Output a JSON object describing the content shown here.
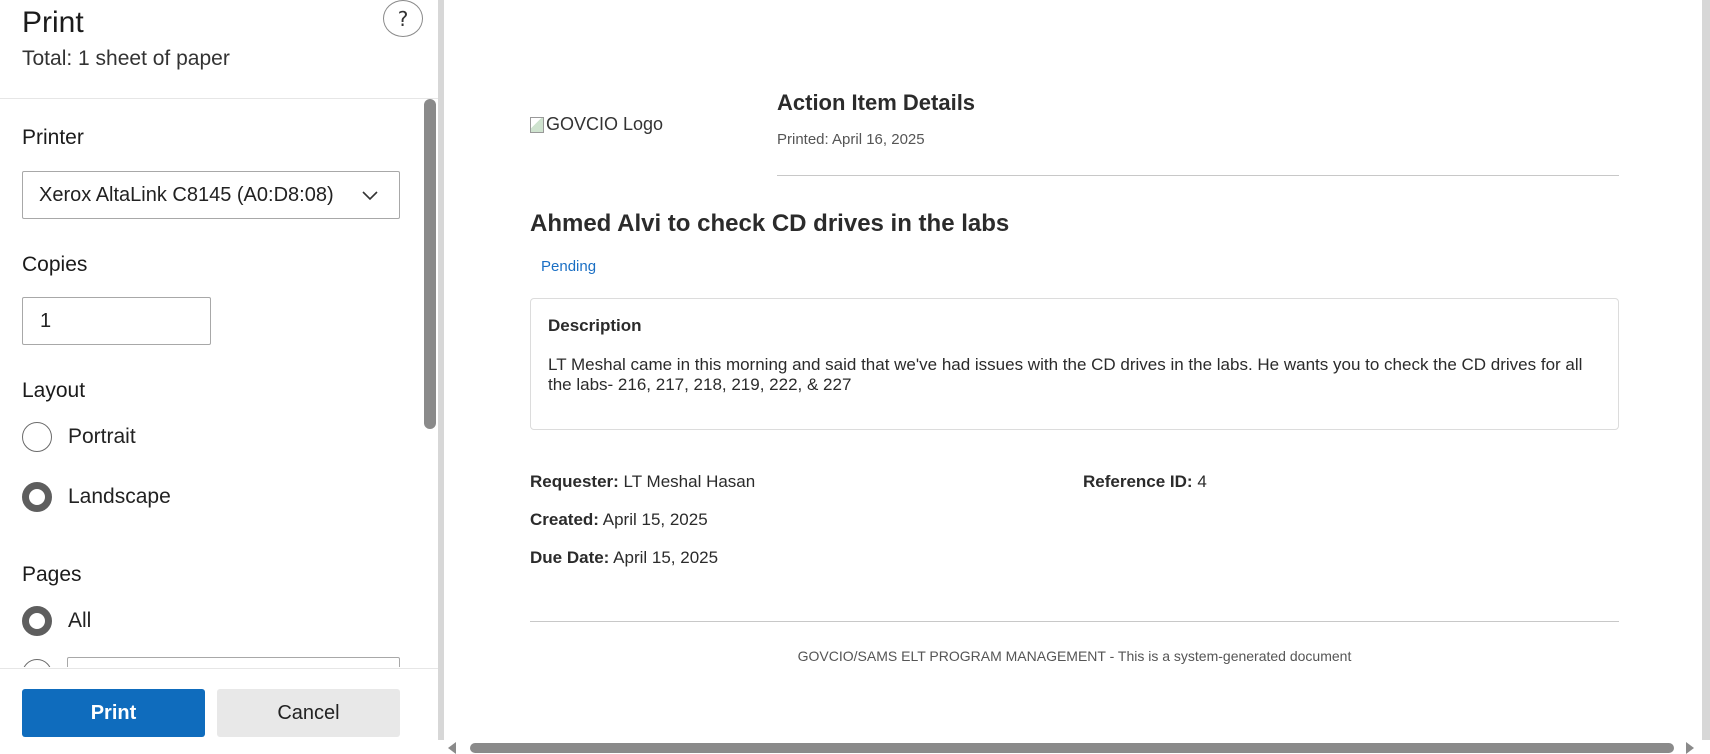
{
  "panel": {
    "title": "Print",
    "total": "Total: 1 sheet of paper",
    "help_label": "?",
    "printer_label": "Printer",
    "printer_value": "Xerox AltaLink C8145 (A0:D8:08)",
    "copies_label": "Copies",
    "copies_value": "1",
    "layout_label": "Layout",
    "layout_options": [
      {
        "label": "Portrait",
        "selected": false
      },
      {
        "label": "Landscape",
        "selected": true
      }
    ],
    "pages_label": "Pages",
    "pages_options": [
      {
        "label": "All",
        "selected": true
      }
    ],
    "print_button": "Print",
    "cancel_button": "Cancel"
  },
  "document": {
    "logo_alt": "GOVCIO Logo",
    "title": "Action Item Details",
    "printed": "Printed: April 16, 2025",
    "item_title": "Ahmed Alvi to check CD drives in the labs",
    "status": "Pending",
    "status_color": "#1a6fc4",
    "description_heading": "Description",
    "description_text": "LT Meshal came in this morning and said that we've had issues with the CD drives in the labs. He wants you to check the CD drives for all the labs- 216, 217, 218, 219, 222, & 227",
    "fields": {
      "requester_label": "Requester:",
      "requester_value": "LT Meshal Hasan",
      "reference_label": "Reference ID:",
      "reference_value": "4",
      "created_label": "Created:",
      "created_value": "April 15, 2025",
      "due_label": "Due Date:",
      "due_value": "April 15, 2025"
    },
    "footer": "GOVCIO/SAMS ELT PROGRAM MANAGEMENT - This is a system-generated document"
  },
  "colors": {
    "accent": "#0f6cbd",
    "cancel_bg": "#e8e8e8"
  }
}
